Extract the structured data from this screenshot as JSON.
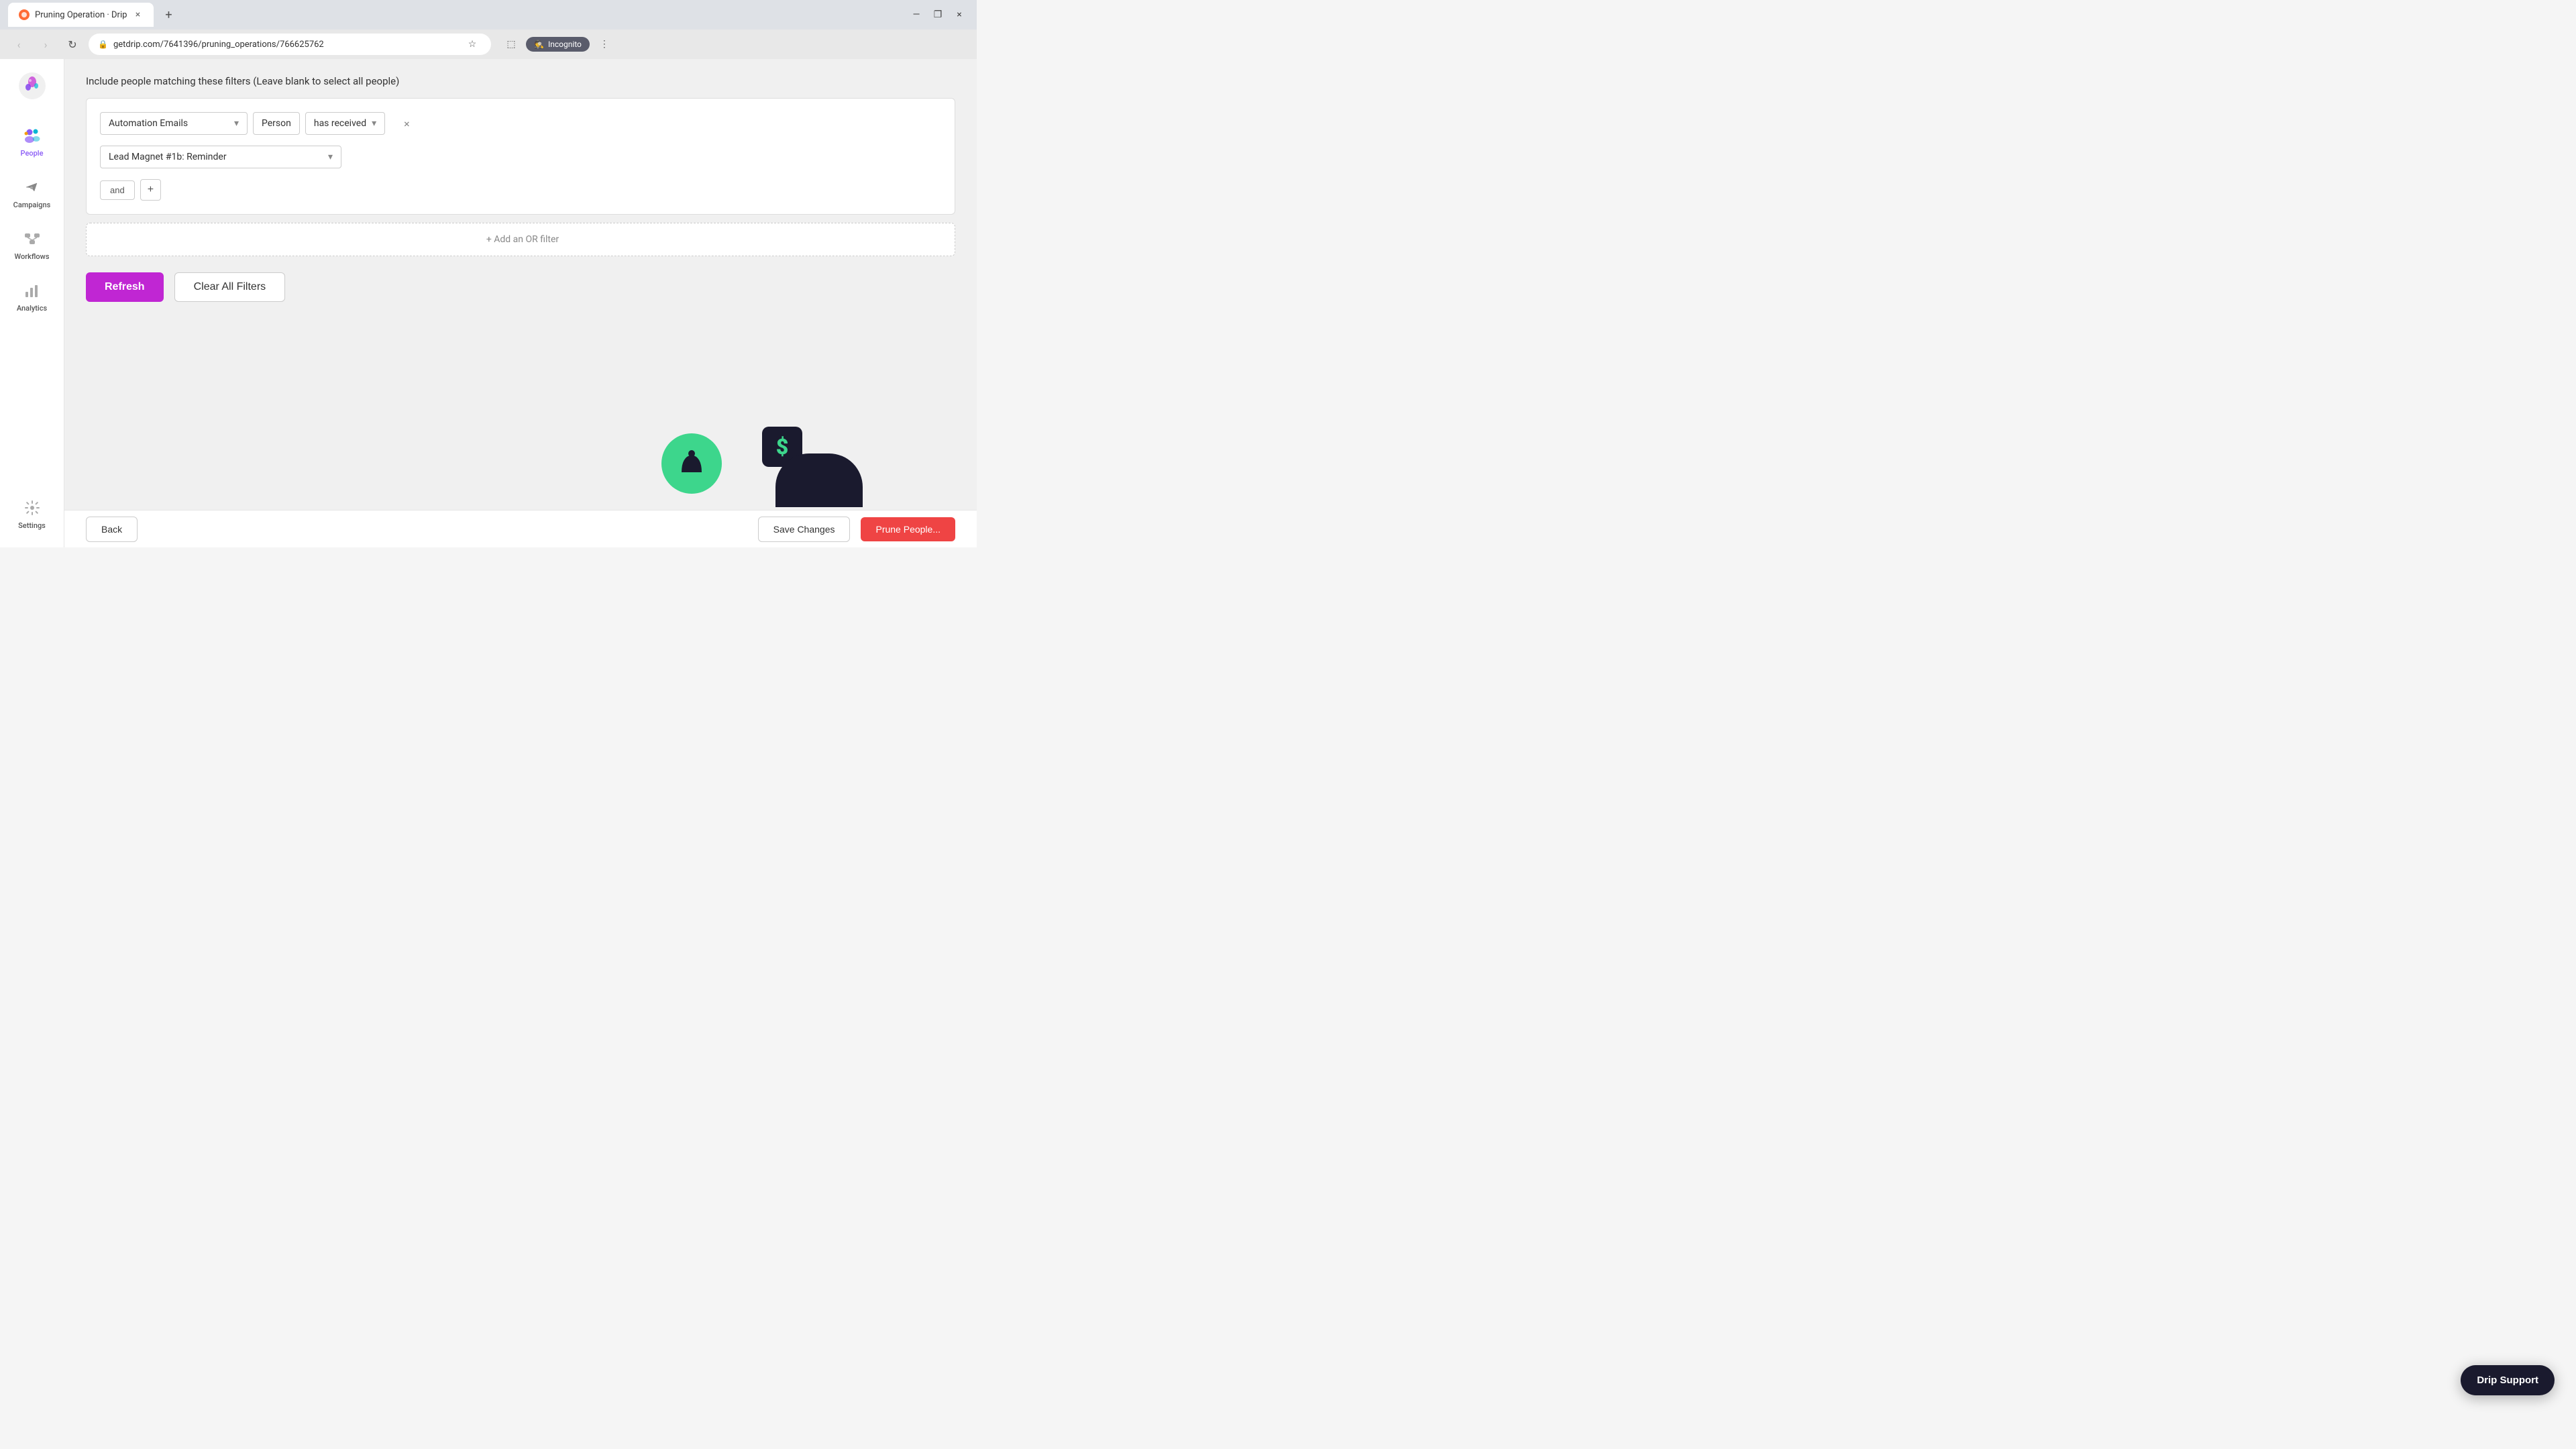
{
  "browser": {
    "tab_title": "Pruning Operation · Drip",
    "url": "getdrip.com/7641396/pruning_operations/766625762",
    "tab_close": "×",
    "tab_new": "+",
    "nav_back": "‹",
    "nav_forward": "›",
    "nav_refresh": "↻",
    "incognito_label": "Incognito",
    "window_minimize": "—",
    "window_maximize": "❐",
    "window_close": "×"
  },
  "sidebar": {
    "logo_alt": "Drip logo",
    "items": [
      {
        "id": "people",
        "label": "People",
        "icon": "👥",
        "active": true
      },
      {
        "id": "campaigns",
        "label": "Campaigns",
        "icon": "📣",
        "active": false
      },
      {
        "id": "workflows",
        "label": "Workflows",
        "icon": "⚡",
        "active": false
      },
      {
        "id": "analytics",
        "label": "Analytics",
        "icon": "📊",
        "active": false
      },
      {
        "id": "settings",
        "label": "Settings",
        "icon": "⚙️",
        "active": false
      }
    ]
  },
  "page": {
    "filter_header": "Include people matching these filters (Leave blank to select all people)",
    "filter_type": "Automation Emails",
    "filter_subject": "Person",
    "filter_condition": "has received",
    "filter_value": "Lead Magnet #1b: Reminder",
    "and_label": "and",
    "plus_label": "+",
    "or_filter_label": "+ Add an OR filter",
    "refresh_label": "Refresh",
    "clear_filters_label": "Clear All Filters"
  },
  "footer": {
    "back_label": "Back",
    "save_label": "Save Changes",
    "prune_label": "Prune People..."
  },
  "drip_support": {
    "label": "Drip Support"
  }
}
